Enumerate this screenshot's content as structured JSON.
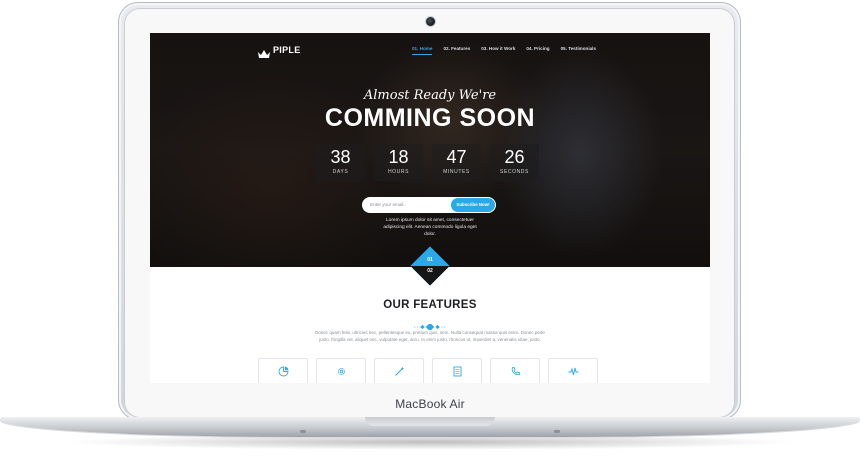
{
  "device": {
    "brand_label": "MacBook Air"
  },
  "site": {
    "logo": "PIPLE",
    "nav": [
      {
        "label": "01. Home",
        "active": true
      },
      {
        "label": "02. Features",
        "active": false
      },
      {
        "label": "03. How it Work",
        "active": false
      },
      {
        "label": "04. Pricing",
        "active": false
      },
      {
        "label": "05. Testimonials",
        "active": false
      }
    ],
    "hero": {
      "tagline": "Almost Ready We're",
      "headline": "COMMING SOON",
      "countdown": [
        {
          "value": "38",
          "label": "DAYS"
        },
        {
          "value": "18",
          "label": "HOURS"
        },
        {
          "value": "47",
          "label": "MINUTES"
        },
        {
          "value": "26",
          "label": "SECONDS"
        }
      ],
      "email_placeholder": "Enter your email..",
      "subscribe_label": "Subscribe Now!",
      "description": "Lorem ipsum dolor sit amet, consectetuer adipiscing elit. Aenean commodo ligula eget dolor."
    },
    "section_indicator": {
      "current": "01",
      "next": "02"
    },
    "features": {
      "title": "OUR FEATURES",
      "description": "Donec quam felis, ultricies nec, pellentesque eu, pretium quis, sem. Nulla consequat massa quis enim. Donec pede justo, fringilla vel, aliquet nec, vulputate eget, arcu. In enim justo, rhoncus ut, imperdiet a, venenatis vitae, justo.",
      "icons": [
        "chart-pie-icon",
        "gear-icon",
        "magic-wand-icon",
        "document-icon",
        "phone-icon",
        "pulse-icon"
      ]
    }
  },
  "colors": {
    "accent": "#2aa8e8",
    "hero_bg": "#1a1614",
    "dark": "#161616"
  }
}
